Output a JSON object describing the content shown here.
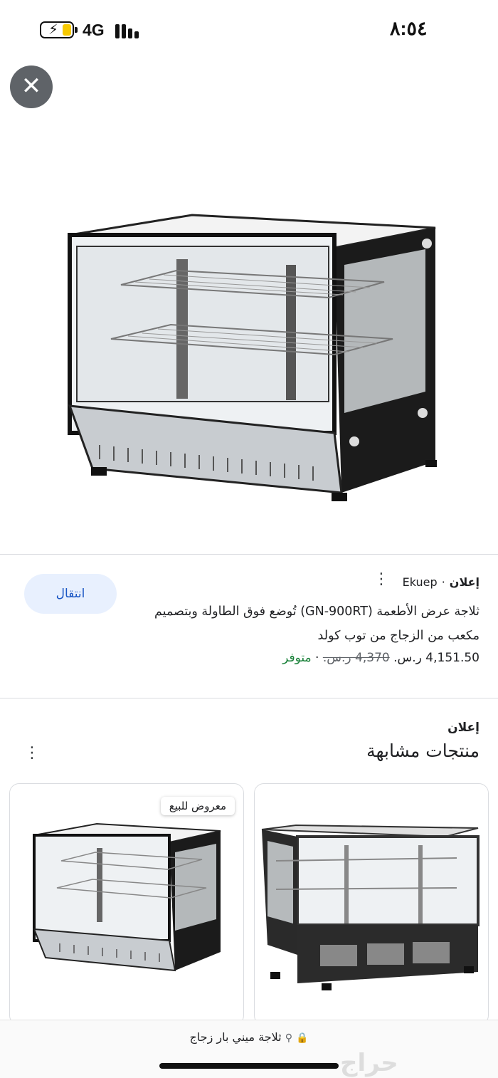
{
  "status_bar": {
    "network": "4G",
    "time": "٨:٥٤",
    "battery_level": 0.3
  },
  "hero": {
    "close_label": "✕",
    "image_alt": "ثلاجة عرض الأطعمة GN-900RT"
  },
  "ad": {
    "tag": "إعلان",
    "separator": "·",
    "seller": "Ekuep",
    "title": "ثلاجة عرض الأطعمة (GN-900RT) تُوضع فوق الطاولة وبتصميم مكعب من الزجاج من توب كولد",
    "price": "4,151.50 ر.س.",
    "old_price": "4,370 ر.س.",
    "stock": "متوفر",
    "visit_label": "انتقال"
  },
  "similar": {
    "tag": "إعلان",
    "title": "منتجات مشابهة",
    "cards": [
      {
        "badge": "معروض للبيع"
      },
      {
        "badge": ""
      }
    ]
  },
  "address_bar": {
    "query": "ثلاجة ميني بار زجاج",
    "lock_icon": "🔒",
    "search_icon": "⚲"
  },
  "watermark": "حراج"
}
